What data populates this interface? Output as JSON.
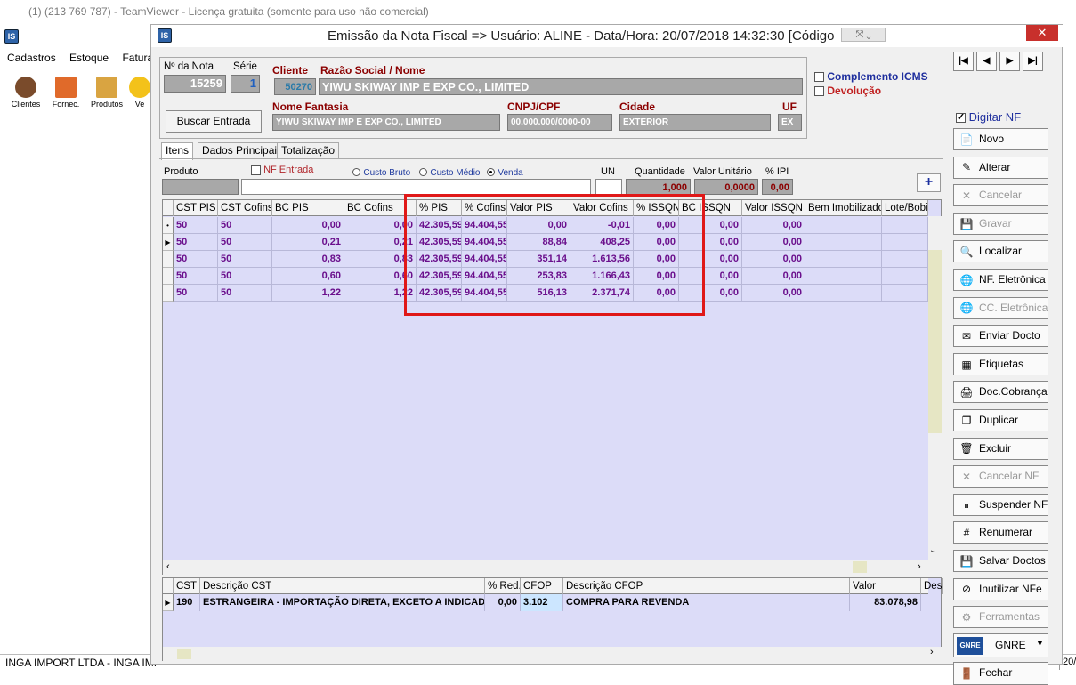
{
  "teamviewer": {
    "title": "(1) (213 769 787) - TeamViewer - Licença gratuita (somente para uso não comercial)"
  },
  "bg_app": {
    "menu": [
      "Cadastros",
      "Estoque",
      "Faturam"
    ],
    "tools": [
      "Clientes",
      "Fornec.",
      "Produtos",
      "Ve"
    ],
    "status": "INGA IMPORT LTDA  -  INGA IMI",
    "status_right": "20/"
  },
  "window": {
    "logo": "IS",
    "title": "Emissão da Nota Fiscal  => Usuário: ALINE - Data/Hora: 20/07/2018 14:32:30  [Código",
    "close": "✕"
  },
  "header": {
    "nota_label": "Nº da Nota",
    "nota_value": "15259",
    "serie_label": "Série",
    "serie_value": "1",
    "cliente_label": "Cliente",
    "cliente_value": "50270",
    "razao_label": "Razão Social / Nome",
    "razao_value": "YIWU SKIWAY IMP E EXP CO., LIMITED",
    "buscar_button": "Buscar Entrada",
    "fantasia_label": "Nome Fantasia",
    "fantasia_value": "YIWU SKIWAY IMP E EXP CO., LIMITED",
    "cnpj_label": "CNPJ/CPF",
    "cnpj_value": "00.000.000/0000-00",
    "cidade_label": "Cidade",
    "cidade_value": "EXTERIOR",
    "uf_label": "UF",
    "uf_value": "EX",
    "complemento_icms": "Complemento ICMS",
    "devolucao": "Devolução"
  },
  "tabs": [
    "Itens",
    "Dados Principais",
    "Totalização"
  ],
  "product": {
    "produto_label": "Produto",
    "nf_entrada": "NF Entrada",
    "custo_bruto": "Custo Bruto",
    "custo_medio": "Custo Médio",
    "venda": "Venda",
    "un_label": "UN",
    "quantidade_label": "Quantidade",
    "quantidade_value": "1,000",
    "valor_unit_label": "Valor Unitário",
    "valor_unit_value": "0,0000",
    "ipi_label": "% IPI",
    "ipi_value": "0,00",
    "plus": "+"
  },
  "grid": {
    "columns": [
      "CST PIS",
      "CST Cofins",
      "BC PIS",
      "BC Cofins",
      "% PIS",
      "% Cofins",
      "Valor PIS",
      "Valor Cofins",
      "% ISSQN",
      "BC ISSQN",
      "Valor ISSQN",
      "Bem Imobilizado",
      "Lote/Bobi"
    ],
    "rows": [
      [
        "50",
        "50",
        "0,00",
        "0,00",
        "42.305,59",
        "94.404,55",
        "0,00",
        "-0,01",
        "0,00",
        "0,00",
        "0,00",
        "",
        ""
      ],
      [
        "50",
        "50",
        "0,21",
        "0,21",
        "42.305,59",
        "94.404,55",
        "88,84",
        "408,25",
        "0,00",
        "0,00",
        "0,00",
        "",
        ""
      ],
      [
        "50",
        "50",
        "0,83",
        "0,83",
        "42.305,59",
        "94.404,55",
        "351,14",
        "1.613,56",
        "0,00",
        "0,00",
        "0,00",
        "",
        ""
      ],
      [
        "50",
        "50",
        "0,60",
        "0,60",
        "42.305,59",
        "94.404,55",
        "253,83",
        "1.166,43",
        "0,00",
        "0,00",
        "0,00",
        "",
        ""
      ],
      [
        "50",
        "50",
        "1,22",
        "1,22",
        "42.305,59",
        "94.404,55",
        "516,13",
        "2.371,74",
        "0,00",
        "0,00",
        "0,00",
        "",
        ""
      ]
    ],
    "row_markers": [
      "•",
      "▶",
      "",
      "",
      ""
    ]
  },
  "cst_grid": {
    "columns": [
      "CST",
      "Descrição CST",
      "% Red.",
      "CFOP",
      "Descrição CFOP",
      "Valor",
      "Des"
    ],
    "row": [
      "190",
      "ESTRANGEIRA - IMPORTAÇÃO DIRETA, EXCETO A INDICADA N",
      "0,00",
      "3.102",
      "COMPRA PARA REVENDA",
      "83.078,98",
      ""
    ],
    "marker": "▶"
  },
  "right_panel": {
    "nav": [
      "|◀",
      "◀",
      "▶",
      "▶|"
    ],
    "digit_nf": "Digitar NF",
    "buttons": [
      {
        "label": "Novo",
        "icon": "📄",
        "enabled": true
      },
      {
        "label": "Alterar",
        "icon": "✎",
        "enabled": true
      },
      {
        "label": "Cancelar",
        "icon": "✕",
        "enabled": false
      },
      {
        "label": "Gravar",
        "icon": "💾",
        "enabled": false
      },
      {
        "label": "Localizar",
        "icon": "🔍",
        "enabled": true
      },
      {
        "label": "NF. Eletrônica",
        "icon": "🌐",
        "enabled": true
      },
      {
        "label": "CC. Eletrônica",
        "icon": "🌐",
        "enabled": false
      },
      {
        "label": "Enviar Docto",
        "icon": "✉",
        "enabled": true
      },
      {
        "label": "Etiquetas",
        "icon": "▦",
        "enabled": true
      },
      {
        "label": "Doc.Cobrança",
        "icon": "🖨",
        "enabled": true
      },
      {
        "label": "Duplicar",
        "icon": "❐",
        "enabled": true
      },
      {
        "label": "Excluir",
        "icon": "🗑",
        "enabled": true
      },
      {
        "label": "Cancelar NF",
        "icon": "✕",
        "enabled": false
      },
      {
        "label": "Suspender NF",
        "icon": "⏸",
        "enabled": true
      },
      {
        "label": "Renumerar",
        "icon": "#",
        "enabled": true
      },
      {
        "label": "Salvar Doctos",
        "icon": "💾",
        "enabled": true
      },
      {
        "label": "Inutilizar NFe",
        "icon": "⊘",
        "enabled": true
      },
      {
        "label": "Ferramentas",
        "icon": "⚙",
        "enabled": false
      }
    ],
    "gnre_label": "GNRE",
    "gnre_icon_text": "GNRE",
    "fechar": "Fechar"
  }
}
